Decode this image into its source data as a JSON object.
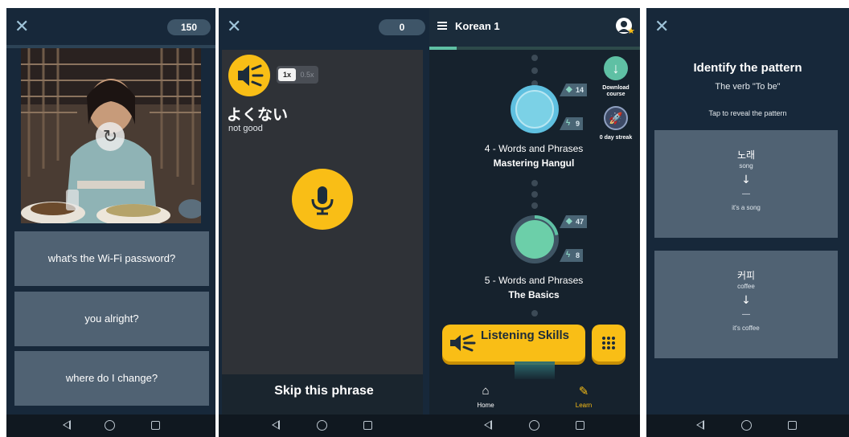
{
  "panel1": {
    "score": "150",
    "progress": 0.0,
    "choices": [
      "what's the Wi-Fi password?",
      "you alright?",
      "where do I change?"
    ]
  },
  "panel2": {
    "score": "0",
    "speed_normal": "1x",
    "speed_slow": "0.5x",
    "phrase": "よくない",
    "translation": "not good",
    "skip_label": "Skip this phrase"
  },
  "panel3": {
    "course_title": "Korean 1",
    "progress": 0.13,
    "download_label": "Download course",
    "streak_label": "0 day streak",
    "units": [
      {
        "title": "4 - Words and Phrases",
        "subtitle": "Mastering Hangul",
        "words_count": "14",
        "review_count": "9"
      },
      {
        "title": "5 - Words and Phrases",
        "subtitle": "The Basics",
        "words_count": "47",
        "review_count": "8"
      }
    ],
    "listening_label": "Listening Skills",
    "tabs": [
      {
        "label": "Home",
        "icon": "home-icon"
      },
      {
        "label": "Learn",
        "icon": "learn-icon"
      }
    ],
    "colors": {
      "accent": "#f9be16",
      "progress": "#5fc0a4",
      "active_tab": "#f9be16"
    }
  },
  "panel4": {
    "title": "Identify the pattern",
    "subtitle": "The verb \"To be\"",
    "instruction": "Tap to reveal the pattern",
    "cards": [
      {
        "korean": "노래",
        "english": "song",
        "arrow": "↓",
        "dash": "—",
        "result": "it's a song"
      },
      {
        "korean": "커피",
        "english": "coffee",
        "arrow": "↓",
        "dash": "—",
        "result": "it's coffee"
      }
    ]
  }
}
